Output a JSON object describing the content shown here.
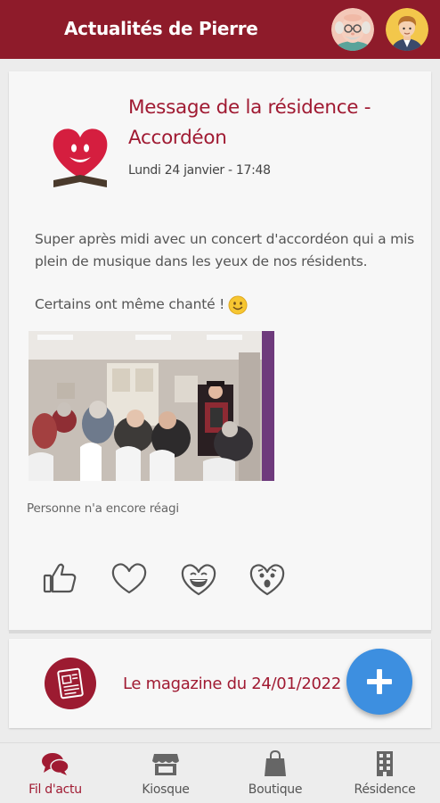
{
  "header": {
    "title": "Actualités de Pierre"
  },
  "post": {
    "title": "Message de la résidence - Accordéon",
    "date": "Lundi 24 janvier - 17:48",
    "paragraph1": "Super après midi avec un concert d'accordéon qui a mis plein de musique dans les yeux de nos résidents.",
    "paragraph2": "Certains ont même chanté !",
    "reactions_summary": "Personne n'a encore réagi",
    "reactions": [
      "thumbs-up-icon",
      "heart-icon",
      "laughing-face-icon",
      "surprised-face-icon"
    ]
  },
  "magazine": {
    "label": "Le magazine du 24/01/2022"
  },
  "nav": {
    "items": [
      {
        "label": "Fil d'actu",
        "icon": "chat-bubbles-icon",
        "active": true
      },
      {
        "label": "Kiosque",
        "icon": "store-icon",
        "active": false
      },
      {
        "label": "Boutique",
        "icon": "shopping-bag-icon",
        "active": false
      },
      {
        "label": "Résidence",
        "icon": "building-icon",
        "active": false
      }
    ]
  },
  "colors": {
    "brand": "#8e1b2a",
    "accent_text": "#a01a32",
    "fab": "#3d8fe0"
  }
}
